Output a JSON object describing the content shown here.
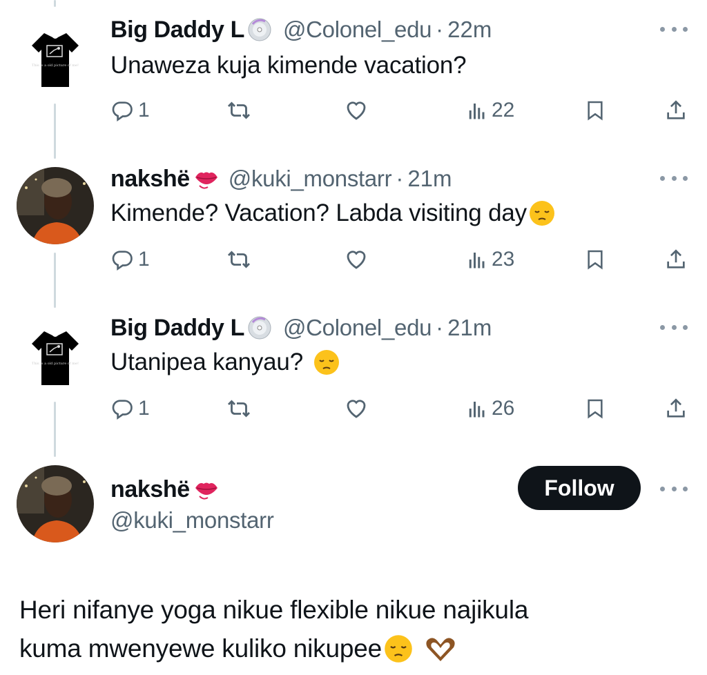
{
  "thread": [
    {
      "name": "Big Daddy L",
      "badge_icon": "cd-disc-icon",
      "handle": "@Colonel_edu",
      "separator": "·",
      "time": "22m",
      "text": "Unaweza kuja kimende vacation?",
      "emoji": "",
      "stats": {
        "replies": "1",
        "views": "22"
      }
    },
    {
      "name": "nakshë",
      "badge_icon": "lips-kiss-icon",
      "handle": "@kuki_monstarr",
      "separator": "·",
      "time": "21m",
      "text": "Kimende? Vacation? Labda visiting day",
      "emoji": "pensive-face",
      "stats": {
        "replies": "1",
        "views": "23"
      }
    },
    {
      "name": "Big Daddy L",
      "badge_icon": "cd-disc-icon",
      "handle": "@Colonel_edu",
      "separator": "·",
      "time": "21m",
      "text": "Utanipea kanyau?",
      "emoji": "pensive-face",
      "stats": {
        "replies": "1",
        "views": "26"
      }
    }
  ],
  "avatar_tshirt_text": "This is a old picture of me!",
  "main_tweet": {
    "name": "nakshë",
    "badge_icon": "lips-kiss-icon",
    "handle": "@kuki_monstarr",
    "follow_label": "Follow",
    "text_line1": "Heri nifanye yoga nikue flexible nikue najikula",
    "text_line2": "kuma mwenyewe kuliko nikupee",
    "emojis": [
      "pensive-face",
      "heart-hands"
    ]
  },
  "colors": {
    "text": "#0f1419",
    "muted": "#536471",
    "thread_line": "#cfd9de",
    "follow_bg": "#0f1419"
  }
}
